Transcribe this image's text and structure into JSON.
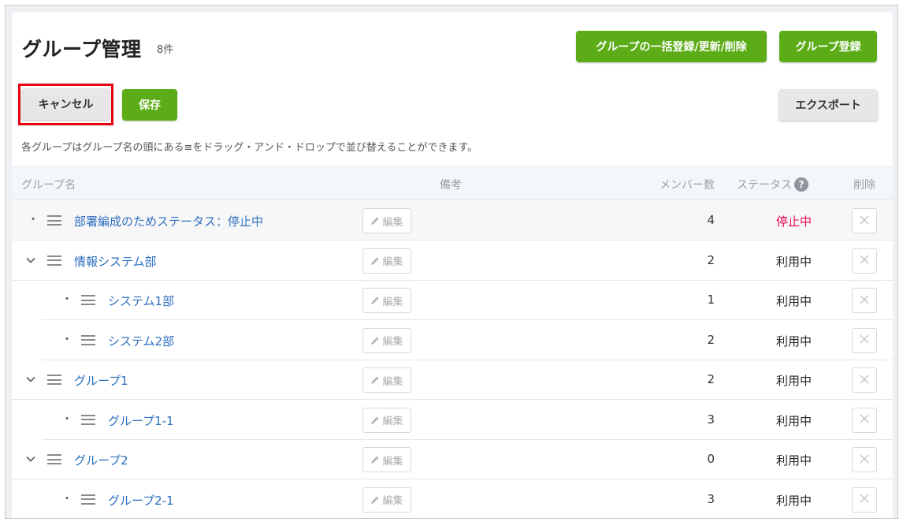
{
  "header": {
    "title": "グループ管理",
    "count": "8件",
    "bulk_button": "グループの一括登録/更新/削除",
    "register_button": "グループ登録"
  },
  "toolbar": {
    "cancel_label": "キャンセル",
    "save_label": "保存",
    "export_label": "エクスポート"
  },
  "hint": "各グループはグループ名の頭にある≡をドラッグ・アンド・ドロップで並び替えることができます。",
  "table": {
    "headers": {
      "name": "グループ名",
      "note": "備考",
      "members": "メンバー数",
      "status": "ステータス",
      "delete": "削除"
    },
    "help_glyph": "?",
    "edit_label": "編集",
    "rows": [
      {
        "name": "部署編成のためステータス：停止中",
        "members": "4",
        "status": "停止中",
        "level": 0,
        "expandable": false
      },
      {
        "name": "情報システム部",
        "members": "2",
        "status": "利用中",
        "level": 0,
        "expandable": true
      },
      {
        "name": "システム1部",
        "members": "1",
        "status": "利用中",
        "level": 1,
        "expandable": false
      },
      {
        "name": "システム2部",
        "members": "2",
        "status": "利用中",
        "level": 1,
        "expandable": false
      },
      {
        "name": "グループ1",
        "members": "2",
        "status": "利用中",
        "level": 0,
        "expandable": true
      },
      {
        "name": "グループ1-1",
        "members": "3",
        "status": "利用中",
        "level": 1,
        "expandable": false
      },
      {
        "name": "グループ2",
        "members": "0",
        "status": "利用中",
        "level": 0,
        "expandable": true
      },
      {
        "name": "グループ2-1",
        "members": "3",
        "status": "利用中",
        "level": 1,
        "expandable": false
      }
    ]
  },
  "colors": {
    "accent_green": "#5bac16",
    "link_blue": "#2d6fbf",
    "stopped_status": "#e6004f",
    "cancel_highlight": "#e60012"
  },
  "icons": {
    "drag_handle": "drag-handle-icon",
    "expand": "chevron-down-icon",
    "edit": "pencil-icon",
    "delete": "close-icon",
    "help": "help-icon"
  }
}
